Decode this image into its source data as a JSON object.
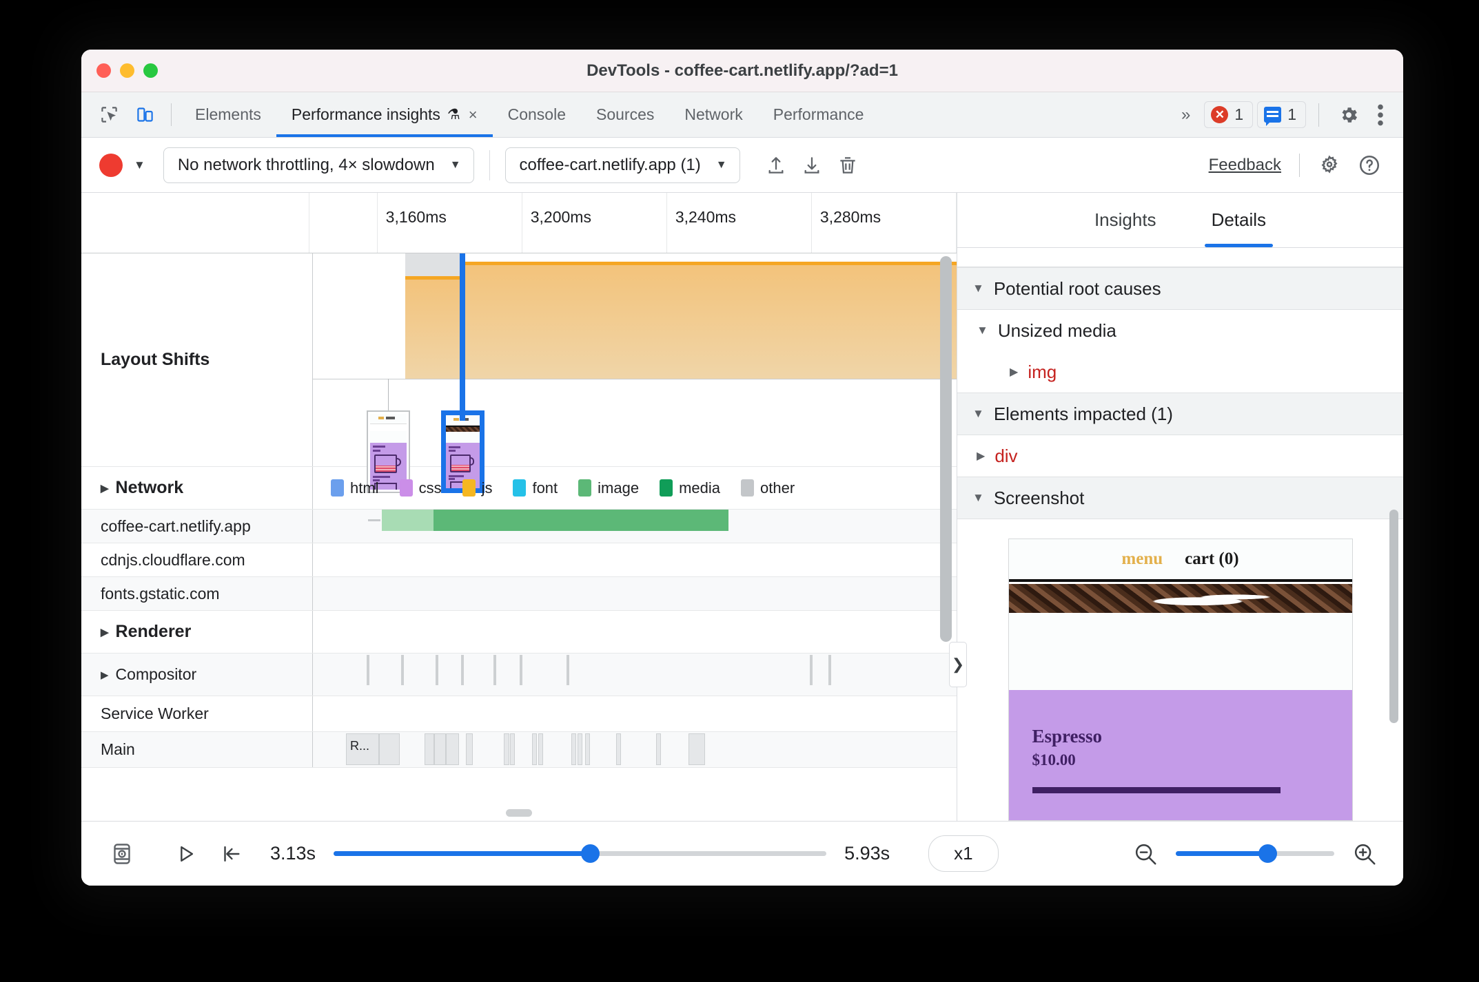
{
  "window": {
    "title": "DevTools - coffee-cart.netlify.app/?ad=1",
    "traffic_lights": [
      "close",
      "minimize",
      "maximize"
    ]
  },
  "tabbar": {
    "left_icons": [
      "inspect-icon",
      "device-toolbar-icon"
    ],
    "tabs": [
      {
        "label": "Elements",
        "active": false,
        "flask": false,
        "closeable": false
      },
      {
        "label": "Performance insights",
        "active": true,
        "flask": true,
        "flask_glyph": "⚗",
        "close_glyph": "×",
        "closeable": true
      },
      {
        "label": "Console",
        "active": false,
        "flask": false,
        "closeable": false
      },
      {
        "label": "Sources",
        "active": false,
        "flask": false,
        "closeable": false
      },
      {
        "label": "Network",
        "active": false,
        "flask": false,
        "closeable": false
      },
      {
        "label": "Performance",
        "active": false,
        "flask": false,
        "closeable": false
      }
    ],
    "more_glyph": "»",
    "error_count": "1",
    "message_count": "1",
    "error_glyph": "✕",
    "settings_icon": "gear-icon",
    "menu_icon": "kebab-menu-icon"
  },
  "toolbar": {
    "record_label": "record",
    "caret_glyph": "▼",
    "throttling": "No network throttling, 4× slowdown",
    "recording_select": "coffee-cart.netlify.app (1)",
    "upload_icon": "upload-icon",
    "download_icon": "download-icon",
    "delete_icon": "trash-icon",
    "feedback": "Feedback",
    "settings_icon": "gear-icon",
    "help_icon": "help-icon"
  },
  "timeline": {
    "ticks": [
      "3,160ms",
      "3,200ms",
      "3,240ms",
      "3,280ms"
    ],
    "rows": [
      {
        "label": "Layout Shifts",
        "expandable": false,
        "bold": true
      },
      {
        "label": "Network",
        "expandable": true,
        "bold": true
      },
      {
        "label": "coffee-cart.netlify.app",
        "expandable": false,
        "bold": false
      },
      {
        "label": "cdnjs.cloudflare.com",
        "expandable": false,
        "bold": false
      },
      {
        "label": "fonts.gstatic.com",
        "expandable": false,
        "bold": false
      },
      {
        "label": "Renderer",
        "expandable": true,
        "bold": true
      },
      {
        "label": "Compositor",
        "expandable": true,
        "bold": false
      },
      {
        "label": "Service Worker",
        "expandable": false,
        "bold": false
      },
      {
        "label": "Main",
        "expandable": false,
        "bold": false
      }
    ],
    "legend": [
      {
        "label": "html",
        "color": "#6b9fed"
      },
      {
        "label": "css",
        "color": "#cb8ee8"
      },
      {
        "label": "js",
        "color": "#f5b722"
      },
      {
        "label": "font",
        "color": "#25c1e8"
      },
      {
        "label": "image",
        "color": "#5cb877"
      },
      {
        "label": "media",
        "color": "#109d58"
      },
      {
        "label": "other",
        "color": "#c3c6c9"
      }
    ],
    "main_block_label": "R...",
    "expander_glyph": "❯"
  },
  "details_pane": {
    "tabs": [
      {
        "label": "Insights",
        "active": false
      },
      {
        "label": "Details",
        "active": true
      }
    ],
    "sections": [
      {
        "title": "Potential root causes",
        "expanded": true,
        "glyph": "▼"
      },
      {
        "title": "Elements impacted (1)",
        "expanded": true,
        "glyph": "▼"
      },
      {
        "title": "Screenshot",
        "expanded": true,
        "glyph": "▼"
      }
    ],
    "root_cause_group": {
      "label": "Unsized media",
      "glyph": "▼"
    },
    "root_cause_item": {
      "label": "img",
      "glyph": "▶"
    },
    "impacted_item": {
      "label": "div",
      "glyph": "▶"
    },
    "screenshot": {
      "menu": "menu",
      "cart": "cart (0)",
      "product_name": "Espresso",
      "product_price": "$10.00"
    }
  },
  "bottombar": {
    "filmstrip_icon": "filmstrip-icon",
    "play_icon": "play-icon",
    "jump-to-start_icon": "jump-to-start-icon",
    "start_time": "3.13s",
    "end_time": "5.93s",
    "playback_speed": "x1",
    "zoom_out_icon": "zoom-out-icon",
    "zoom_in_icon": "zoom-in-icon",
    "range_percent": 52,
    "zoom_percent": 58
  },
  "colors": {
    "accent": "#1a73e8",
    "error": "#dc3c28",
    "amber": "#f5a623",
    "tag": "#c5221f"
  }
}
